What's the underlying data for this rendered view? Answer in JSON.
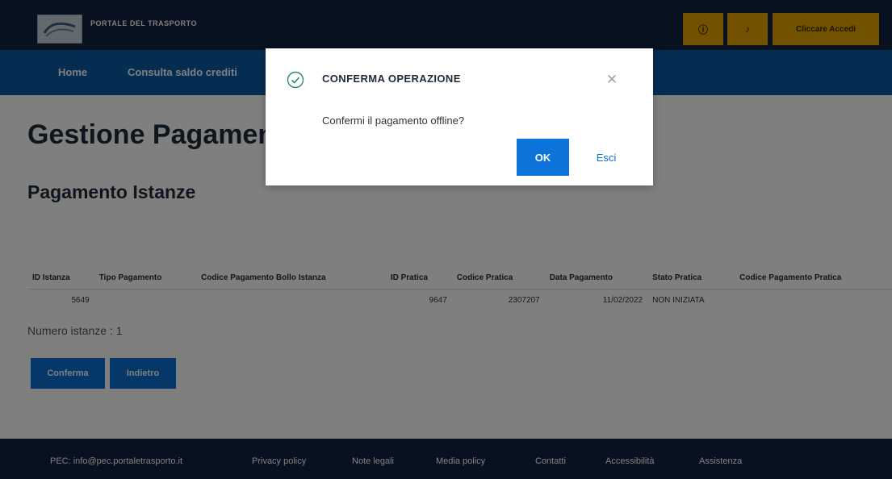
{
  "header": {
    "brand": "PORTALE DEL TRASPORTO",
    "icon_buttons": [
      "info-icon",
      "bell-icon"
    ],
    "user_button": "Cliccare Accedi"
  },
  "nav": {
    "items": [
      "Home",
      "Consulta saldo crediti"
    ]
  },
  "main": {
    "page_title": "Gestione Pagamenti",
    "section_title": "Pagamento Istanze",
    "table": {
      "columns": [
        "ID Istanza",
        "Tipo Pagamento",
        "Codice Pagamento Bollo Istanza",
        "ID Pratica",
        "Codice Pratica",
        "Data Pagamento",
        "Stato Pratica",
        "Codice Pagamento Pratica"
      ],
      "rows": [
        [
          "5649",
          "",
          "",
          "9647",
          "2307207",
          "11/02/2022",
          "NON INIZIATA",
          ""
        ]
      ]
    },
    "count_label": "Numero istanze : 1",
    "confirm_button": "Conferma",
    "cancel_button": "Indietro"
  },
  "footer": {
    "items": [
      "PEC: info@pec.portaletrasporto.it",
      "Privacy policy",
      "Note legali",
      "Media policy",
      "Contatti",
      "Accessibilità",
      "Assistenza"
    ]
  },
  "dialog": {
    "title": "CONFERMA OPERAZIONE",
    "message": "Confermi il pagamento offline?",
    "ok_label": "OK",
    "exit_label": "Esci",
    "accent": "#0b73d9",
    "icon": "check-circle-icon"
  }
}
